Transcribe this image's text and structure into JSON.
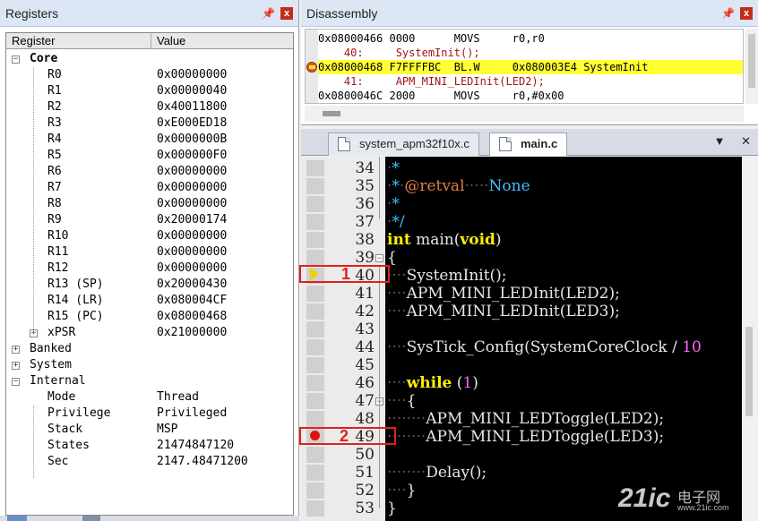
{
  "registers": {
    "title": "Registers",
    "pin_icon": "pin-icon",
    "close_label": "x",
    "columns": [
      "Register",
      "Value"
    ],
    "groups": {
      "core": "Core",
      "banked": "Banked",
      "system": "System",
      "internal": "Internal"
    },
    "core_rows": [
      {
        "name": "R0",
        "value": "0x00000000"
      },
      {
        "name": "R1",
        "value": "0x00000040"
      },
      {
        "name": "R2",
        "value": "0x40011800"
      },
      {
        "name": "R3",
        "value": "0xE000ED18"
      },
      {
        "name": "R4",
        "value": "0x0000000B"
      },
      {
        "name": "R5",
        "value": "0x000000F0"
      },
      {
        "name": "R6",
        "value": "0x00000000"
      },
      {
        "name": "R7",
        "value": "0x00000000"
      },
      {
        "name": "R8",
        "value": "0x00000000"
      },
      {
        "name": "R9",
        "value": "0x20000174"
      },
      {
        "name": "R10",
        "value": "0x00000000"
      },
      {
        "name": "R11",
        "value": "0x00000000"
      },
      {
        "name": "R12",
        "value": "0x00000000"
      },
      {
        "name": "R13 (SP)",
        "value": "0x20000430"
      },
      {
        "name": "R14 (LR)",
        "value": "0x080004CF"
      },
      {
        "name": "R15 (PC)",
        "value": "0x08000468"
      },
      {
        "name": "xPSR",
        "value": "0x21000000"
      }
    ],
    "internal_rows": [
      {
        "name": "Mode",
        "value": "Thread"
      },
      {
        "name": "Privilege",
        "value": "Privileged"
      },
      {
        "name": "Stack",
        "value": "MSP"
      },
      {
        "name": "States",
        "value": "21474847120"
      },
      {
        "name": "Sec",
        "value": "2147.48471200"
      }
    ]
  },
  "disassembly": {
    "title": "Disassembly",
    "close_label": "x",
    "lines": [
      {
        "text": "0x08000466 0000      MOVS     r0,r0",
        "kind": "asm"
      },
      {
        "text": "    40:     SystemInit();",
        "kind": "src"
      },
      {
        "text": "0x08000468 F7FFFFBC  BL.W     0x080003E4 SystemInit",
        "kind": "cur"
      },
      {
        "text": "    41:     APM_MINI_LEDInit(LED2);",
        "kind": "src"
      },
      {
        "text": "0x0800046C 2000      MOVS     r0,#0x00",
        "kind": "asm"
      }
    ]
  },
  "editor": {
    "tabs": [
      {
        "label": "system_apm32f10x.c",
        "active": false
      },
      {
        "label": "main.c",
        "active": true
      }
    ],
    "menu_label": "▼",
    "close_label": "✕",
    "lines": [
      {
        "num": "34"
      },
      {
        "num": "35"
      },
      {
        "num": "36"
      },
      {
        "num": "37"
      },
      {
        "num": "38"
      },
      {
        "num": "39"
      },
      {
        "num": "40"
      },
      {
        "num": "41"
      },
      {
        "num": "42"
      },
      {
        "num": "43"
      },
      {
        "num": "44"
      },
      {
        "num": "45"
      },
      {
        "num": "46"
      },
      {
        "num": "47"
      },
      {
        "num": "48"
      },
      {
        "num": "49"
      },
      {
        "num": "50"
      },
      {
        "num": "51"
      },
      {
        "num": "52"
      },
      {
        "num": "53"
      }
    ],
    "code": {
      "l34": "*",
      "l35_tag": "@retval",
      "l35_val": "None",
      "l36": "*",
      "l37": "*/",
      "l38_kw": "int",
      "l38_name": " main(",
      "l38_kw2": "void",
      "l38_end": ")",
      "l39": "{",
      "l40": "SystemInit();",
      "l41": "APM_MINI_LEDInit(LED2);",
      "l42": "APM_MINI_LEDInit(LED3);",
      "l44_a": "SysTick_Config(SystemCoreClock / ",
      "l44_num": "10",
      "l46_kw": "while",
      "l46_a": " (",
      "l46_num": "1",
      "l46_b": ")",
      "l47": "{",
      "l48": "APM_MINI_LEDToggle(LED2);",
      "l49": "APM_MINI_LEDToggle(LED3);",
      "l51": "Delay();",
      "l52": "}",
      "l53": "}"
    },
    "annotations": {
      "label1": "1",
      "label2": "2"
    }
  },
  "watermark": {
    "main": "21ic",
    "cn": "电子网",
    "url": "www.21ic.com"
  },
  "colors": {
    "current_line": "#ffff33",
    "annotation": "#e02020",
    "breakpoint": "#e01010"
  }
}
